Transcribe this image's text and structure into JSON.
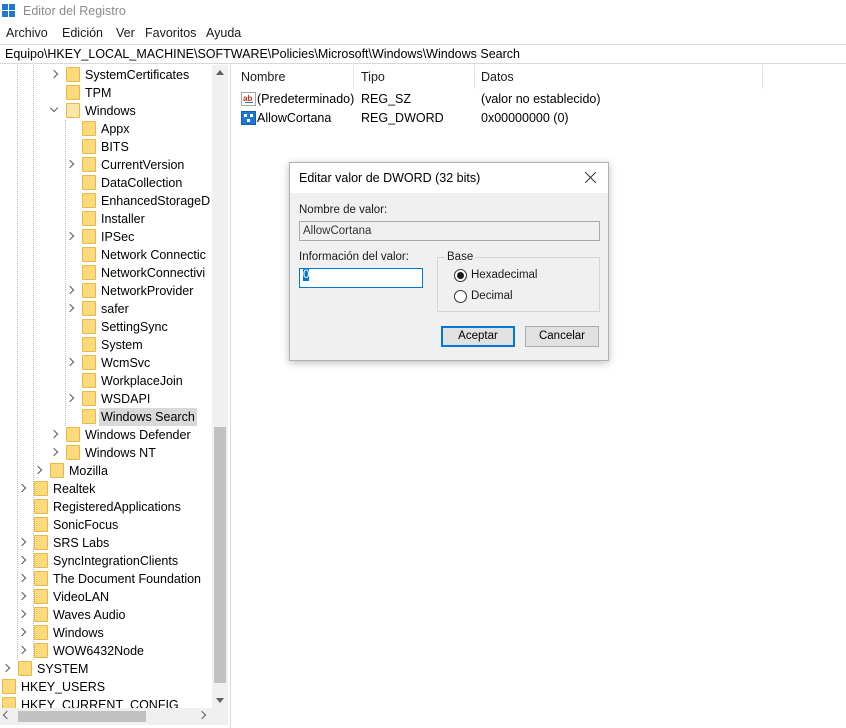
{
  "window": {
    "title": "Editor del Registro"
  },
  "menu": [
    "Archivo",
    "Edición",
    "Ver",
    "Favoritos",
    "Ayuda"
  ],
  "address": "Equipo\\HKEY_LOCAL_MACHINE\\SOFTWARE\\Policies\\Microsoft\\Windows\\Windows Search",
  "tree": [
    {
      "label": "SystemCertificates",
      "expander": "collapsed",
      "icon": "folder-icon"
    },
    {
      "label": "TPM",
      "expander": "none",
      "icon": "folder-icon"
    },
    {
      "label": "Windows",
      "expander": "expanded",
      "icon": "folder-open-icon"
    },
    {
      "label": "Appx",
      "expander": "none",
      "icon": "folder-icon"
    },
    {
      "label": "BITS",
      "expander": "none",
      "icon": "folder-icon"
    },
    {
      "label": "CurrentVersion",
      "expander": "collapsed",
      "icon": "folder-icon"
    },
    {
      "label": "DataCollection",
      "expander": "none",
      "icon": "folder-icon"
    },
    {
      "label": "EnhancedStorageD",
      "expander": "none",
      "icon": "folder-icon"
    },
    {
      "label": "Installer",
      "expander": "none",
      "icon": "folder-icon"
    },
    {
      "label": "IPSec",
      "expander": "collapsed",
      "icon": "folder-icon"
    },
    {
      "label": "Network Connectic",
      "expander": "none",
      "icon": "folder-icon"
    },
    {
      "label": "NetworkConnectivi",
      "expander": "none",
      "icon": "folder-icon"
    },
    {
      "label": "NetworkProvider",
      "expander": "collapsed",
      "icon": "folder-icon"
    },
    {
      "label": "safer",
      "expander": "collapsed",
      "icon": "folder-icon"
    },
    {
      "label": "SettingSync",
      "expander": "none",
      "icon": "folder-icon"
    },
    {
      "label": "System",
      "expander": "none",
      "icon": "folder-icon"
    },
    {
      "label": "WcmSvc",
      "expander": "collapsed",
      "icon": "folder-icon"
    },
    {
      "label": "WorkplaceJoin",
      "expander": "none",
      "icon": "folder-icon"
    },
    {
      "label": "WSDAPI",
      "expander": "collapsed",
      "icon": "folder-icon"
    },
    {
      "label": "Windows Search",
      "expander": "none",
      "icon": "folder-icon",
      "selected": true
    },
    {
      "label": "Windows Defender",
      "expander": "collapsed",
      "icon": "folder-icon"
    },
    {
      "label": "Windows NT",
      "expander": "collapsed",
      "icon": "folder-icon"
    },
    {
      "label": "Mozilla",
      "expander": "collapsed",
      "icon": "folder-icon"
    },
    {
      "label": "Realtek",
      "expander": "collapsed",
      "icon": "folder-icon"
    },
    {
      "label": "RegisteredApplications",
      "expander": "none",
      "icon": "folder-icon"
    },
    {
      "label": "SonicFocus",
      "expander": "none",
      "icon": "folder-icon"
    },
    {
      "label": "SRS Labs",
      "expander": "collapsed",
      "icon": "folder-icon"
    },
    {
      "label": "SyncIntegrationClients",
      "expander": "collapsed",
      "icon": "folder-icon"
    },
    {
      "label": "The Document Foundation",
      "expander": "collapsed",
      "icon": "folder-icon"
    },
    {
      "label": "VideoLAN",
      "expander": "collapsed",
      "icon": "folder-icon"
    },
    {
      "label": "Waves Audio",
      "expander": "collapsed",
      "icon": "folder-icon"
    },
    {
      "label": "Windows",
      "expander": "collapsed",
      "icon": "folder-icon"
    },
    {
      "label": "WOW6432Node",
      "expander": "collapsed",
      "icon": "folder-icon"
    },
    {
      "label": "SYSTEM",
      "expander": "collapsed",
      "icon": "folder-icon"
    },
    {
      "label": "HKEY_USERS",
      "expander": "collapsed",
      "icon": "folder-icon"
    },
    {
      "label": "HKEY_CURRENT_CONFIG",
      "expander": "collapsed",
      "icon": "folder-icon"
    }
  ],
  "list": {
    "columns": [
      "Nombre",
      "Tipo",
      "Datos"
    ],
    "rows": [
      {
        "icon": "string-value-icon",
        "name": "(Predeterminado)",
        "type": "REG_SZ",
        "data": "(valor no establecido)"
      },
      {
        "icon": "binary-value-icon",
        "name": "AllowCortana",
        "type": "REG_DWORD",
        "data": "0x00000000 (0)"
      }
    ]
  },
  "dialog": {
    "title": "Editar valor de DWORD (32 bits)",
    "value_name_label": "Nombre de valor:",
    "value_name": "AllowCortana",
    "value_data_label": "Información del valor:",
    "value_data": "0",
    "base_label": "Base",
    "hex_label": "Hexadecimal",
    "dec_label": "Decimal",
    "base_selected": "Hexadecimal",
    "ok_label": "Aceptar",
    "cancel_label": "Cancelar"
  },
  "colors": {
    "accent": "#0078d7",
    "folder": "#fcd97a",
    "selection": "#d9d9d9"
  }
}
